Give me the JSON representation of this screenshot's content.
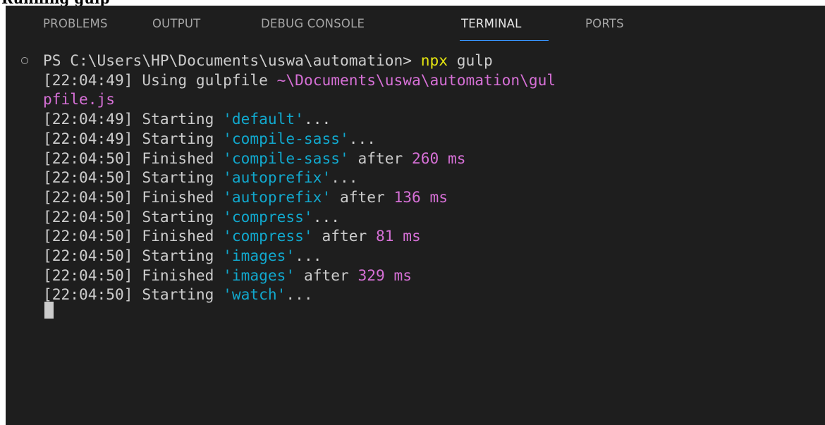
{
  "heading_fragment": "Running gulp",
  "tabs": [
    {
      "label": "PROBLEMS",
      "active": false
    },
    {
      "label": "OUTPUT",
      "active": false
    },
    {
      "label": "DEBUG CONSOLE",
      "active": false
    },
    {
      "label": "TERMINAL",
      "active": true
    },
    {
      "label": "PORTS",
      "active": false
    }
  ],
  "terminal": {
    "prompt": "PS C:\\Users\\HP\\Documents\\uswa\\automation> ",
    "command": "npx",
    "command_args": " gulp",
    "lines": [
      {
        "time": "[22:04:49]",
        "action": " Using gulpfile ",
        "path": "~\\Documents\\uswa\\automation\\gul"
      },
      {
        "path": "pfile.js"
      },
      {
        "time": "[22:04:49]",
        "action": " Starting ",
        "task": "'default'",
        "suffix": "..."
      },
      {
        "time": "[22:04:49]",
        "action": " Starting ",
        "task": "'compile-sass'",
        "suffix": "..."
      },
      {
        "time": "[22:04:50]",
        "action": " Finished ",
        "task": "'compile-sass'",
        "suffix": " after ",
        "duration": "260 ms"
      },
      {
        "time": "[22:04:50]",
        "action": " Starting ",
        "task": "'autoprefix'",
        "suffix": "..."
      },
      {
        "time": "[22:04:50]",
        "action": " Finished ",
        "task": "'autoprefix'",
        "suffix": " after ",
        "duration": "136 ms"
      },
      {
        "time": "[22:04:50]",
        "action": " Starting ",
        "task": "'compress'",
        "suffix": "..."
      },
      {
        "time": "[22:04:50]",
        "action": " Finished ",
        "task": "'compress'",
        "suffix": " after ",
        "duration": "81 ms"
      },
      {
        "time": "[22:04:50]",
        "action": " Starting ",
        "task": "'images'",
        "suffix": "..."
      },
      {
        "time": "[22:04:50]",
        "action": " Finished ",
        "task": "'images'",
        "suffix": " after ",
        "duration": "329 ms"
      },
      {
        "time": "[22:04:50]",
        "action": " Starting ",
        "task": "'watch'",
        "suffix": "..."
      }
    ]
  },
  "colors": {
    "background": "#1e1e1e",
    "text": "#cccccc",
    "command": "#e5e510",
    "path": "#d670d6",
    "task": "#11a8cd",
    "duration": "#d670d6",
    "tab_active_underline": "#3794ff"
  },
  "icons": {
    "status": "circle-outline-icon"
  }
}
